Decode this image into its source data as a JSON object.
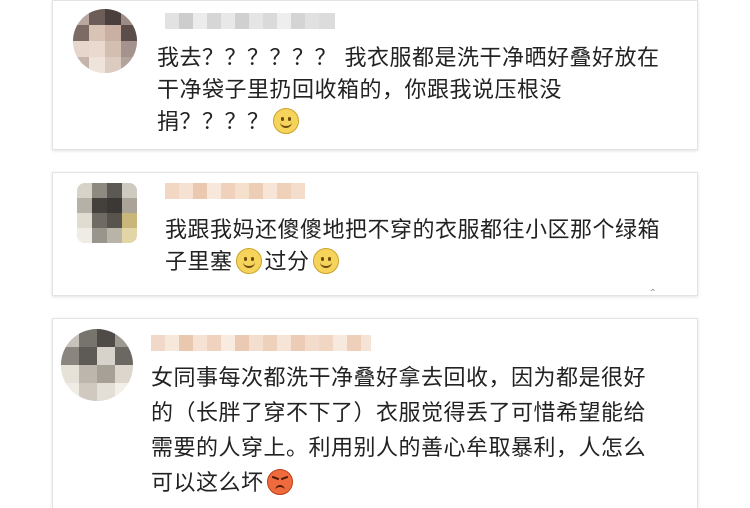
{
  "comments": [
    {
      "lines": [
        "我去？？？？？？ 我衣服都是洗干净晒好叠好放在",
        "干净袋子里扔回收箱的，你跟我说压根没",
        "捐？？？？"
      ],
      "trailing_emoji": "smile-emoji"
    },
    {
      "lines": [
        "我跟我妈还傻傻地把不穿的衣服都往小区那个绿箱",
        "子里塞"
      ],
      "inline_text": "过分",
      "trailing_emoji": "smile-emoji"
    },
    {
      "lines": [
        "女同事每次都洗干净叠好拿去回收，因为都是很好",
        "的（长胖了穿不下了）衣服觉得丢了可惜希望能给",
        "需要的人穿上。利用别人的善心牟取暴利，人怎么",
        "可以这么坏"
      ],
      "trailing_emoji": "angry-emoji"
    }
  ],
  "colors": {
    "text": "#222222",
    "card_border": "#e3e3e3",
    "background": "#ffffff"
  }
}
